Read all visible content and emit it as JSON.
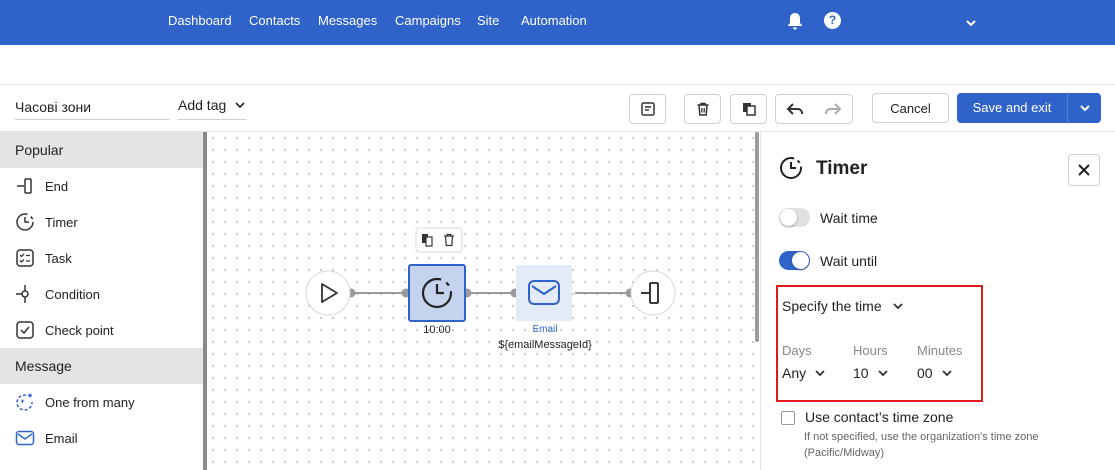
{
  "topnav": {
    "items": [
      "Dashboard",
      "Contacts",
      "Messages",
      "Campaigns",
      "Site",
      "Automation"
    ],
    "icons": [
      "bell-icon",
      "help-icon",
      "chevron-down-icon"
    ],
    "accent_color": "#2f63c9"
  },
  "toolbar": {
    "name_value": "Часові зони",
    "add_tag_label": "Add tag",
    "buttons": [
      "notes-icon",
      "trash-icon",
      "copy-icon",
      "undo-icon",
      "redo-icon"
    ],
    "cancel_label": "Cancel",
    "save_label": "Save and exit"
  },
  "sidebar": {
    "sections": [
      {
        "title": "Popular",
        "items": [
          {
            "label": "End",
            "icon": "end-icon"
          },
          {
            "label": "Timer",
            "icon": "timer-icon"
          },
          {
            "label": "Task",
            "icon": "task-icon"
          },
          {
            "label": "Condition",
            "icon": "condition-icon"
          },
          {
            "label": "Check point",
            "icon": "check-point-icon"
          }
        ]
      },
      {
        "title": "Message",
        "items": [
          {
            "label": "One from many",
            "icon": "one-from-many-icon"
          },
          {
            "label": "Email",
            "icon": "email-icon"
          }
        ]
      }
    ]
  },
  "canvas": {
    "timer_node_label": "10:00",
    "email_node_type": "Email",
    "email_node_label": "${emailMessageId}"
  },
  "panel": {
    "title": "Timer",
    "wait_time_label": "Wait time",
    "wait_time_on": false,
    "wait_until_label": "Wait until",
    "wait_until_on": true,
    "specify_label": "Specify the time",
    "days_label": "Days",
    "days_value": "Any",
    "hours_label": "Hours",
    "hours_value": "10",
    "minutes_label": "Minutes",
    "minutes_value": "00",
    "timezone_label": "Use contact’s time zone",
    "timezone_note": "If not specified, use the organization's time zone (Pacific/Midway)"
  }
}
